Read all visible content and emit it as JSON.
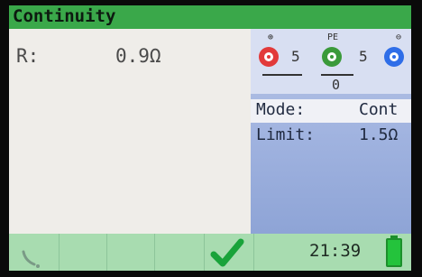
{
  "header": {
    "title": "Continuity"
  },
  "measurement": {
    "r_label": "R:",
    "r_value": "0.9Ω"
  },
  "terminals": {
    "left_symbol": "⊕",
    "middle_symbol": "PE",
    "right_symbol": "⊖",
    "left_value": "5",
    "middle_value": "0",
    "right_value": "5",
    "colors": {
      "left": "#e23a3a",
      "middle": "#3a9a3a",
      "right": "#2f6ee8"
    }
  },
  "settings": {
    "mode_label": "Mode:",
    "mode_value": "Cont",
    "limit_label": "Limit:",
    "limit_value": "1.5Ω"
  },
  "statusbar": {
    "time": "21:39",
    "icons": [
      "phone-icon",
      "checkmark-icon",
      "battery-icon"
    ]
  }
}
